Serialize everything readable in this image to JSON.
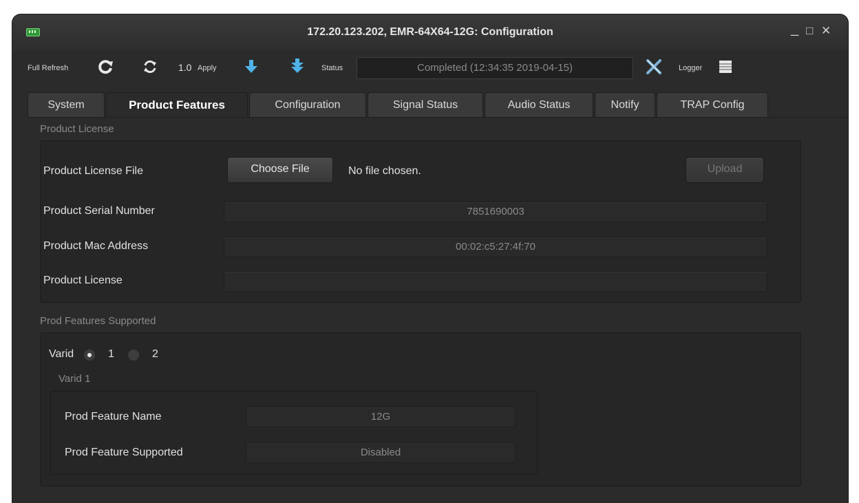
{
  "window": {
    "title": "172.20.123.202, EMR-64X64-12G: Configuration",
    "controls": {
      "minimize": "_",
      "maximize": "□",
      "close": "✕"
    }
  },
  "toolbar": {
    "full_refresh_label": "Full Refresh",
    "refresh_interval": "1.0",
    "apply_label": "Apply",
    "status_label": "Status",
    "status_value": "Completed  (12:34:35 2019-04-15)",
    "logger_label": "Logger"
  },
  "tabs": [
    {
      "label": "System"
    },
    {
      "label": "Product Features",
      "active": true
    },
    {
      "label": "Configuration"
    },
    {
      "label": "Signal Status"
    },
    {
      "label": "Audio Status"
    },
    {
      "label": "Notify"
    },
    {
      "label": "TRAP Config"
    }
  ],
  "product_license": {
    "section_title": "Product License",
    "file_label": "Product License File",
    "choose_file_label": "Choose File",
    "file_status": "No file chosen.",
    "upload_label": "Upload",
    "serial_label": "Product Serial Number",
    "serial_value": "7851690003",
    "mac_label": "Product Mac Address",
    "mac_value": "00:02:c5:27:4f:70",
    "license_label": "Product License",
    "license_value": ""
  },
  "features": {
    "section_title": "Prod Features Supported",
    "varid_label": "Varid",
    "varid_options": [
      "1",
      "2"
    ],
    "varid_selected": "1",
    "varid_group_title": "Varid 1",
    "feature_name_label": "Prod Feature Name",
    "feature_name_value": "12G",
    "feature_supported_label": "Prod Feature Supported",
    "feature_supported_value": "Disabled"
  },
  "colors": {
    "window_bg": "#2b2b2b",
    "panel_bg": "#262626",
    "accent_blue": "#4fb3e8",
    "logger_x": "#7fb3d9"
  }
}
